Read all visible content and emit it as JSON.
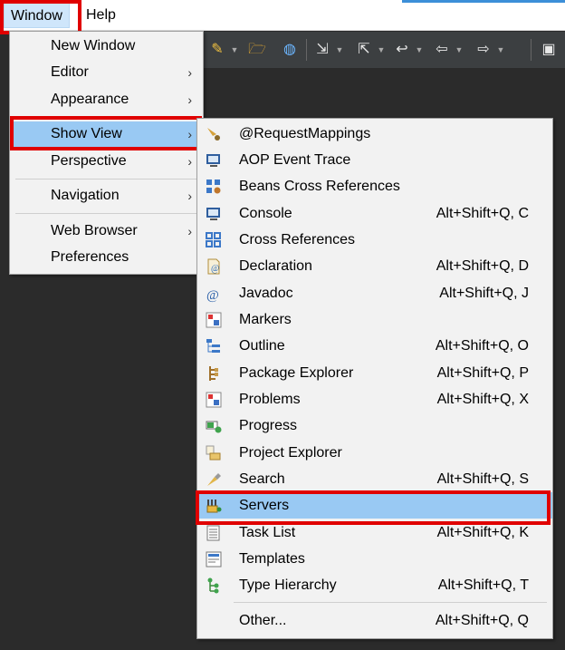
{
  "menubar": {
    "window_label": "Window",
    "help_label": "Help"
  },
  "toolbar": {
    "icons": [
      "pencil-icon",
      "folder-open-icon",
      "globe-icon",
      "export-icon",
      "import-icon",
      "back-history-icon",
      "back-icon",
      "forward-icon",
      "maximize-icon"
    ]
  },
  "window_menu": {
    "items": [
      {
        "label": "New Window",
        "submenu": false
      },
      {
        "label": "Editor",
        "submenu": true
      },
      {
        "label": "Appearance",
        "submenu": true
      },
      {
        "label": "Show View",
        "submenu": true,
        "selected": true
      },
      {
        "label": "Perspective",
        "submenu": true
      },
      {
        "label": "Navigation",
        "submenu": true
      },
      {
        "label": "Web Browser",
        "submenu": true
      },
      {
        "label": "Preferences",
        "submenu": false
      }
    ]
  },
  "show_view_menu": {
    "items": [
      {
        "label": "@RequestMappings",
        "shortcut": "",
        "icon": "request-mappings-icon"
      },
      {
        "label": "AOP Event Trace",
        "shortcut": "",
        "icon": "aop-trace-icon"
      },
      {
        "label": "Beans Cross References",
        "shortcut": "",
        "icon": "beans-xref-icon"
      },
      {
        "label": "Console",
        "shortcut": "Alt+Shift+Q, C",
        "icon": "console-icon"
      },
      {
        "label": "Cross References",
        "shortcut": "",
        "icon": "cross-references-icon"
      },
      {
        "label": "Declaration",
        "shortcut": "Alt+Shift+Q, D",
        "icon": "declaration-icon"
      },
      {
        "label": "Javadoc",
        "shortcut": "Alt+Shift+Q, J",
        "icon": "javadoc-icon"
      },
      {
        "label": "Markers",
        "shortcut": "",
        "icon": "markers-icon"
      },
      {
        "label": "Outline",
        "shortcut": "Alt+Shift+Q, O",
        "icon": "outline-icon"
      },
      {
        "label": "Package Explorer",
        "shortcut": "Alt+Shift+Q, P",
        "icon": "package-explorer-icon"
      },
      {
        "label": "Problems",
        "shortcut": "Alt+Shift+Q, X",
        "icon": "problems-icon"
      },
      {
        "label": "Progress",
        "shortcut": "",
        "icon": "progress-icon"
      },
      {
        "label": "Project Explorer",
        "shortcut": "",
        "icon": "project-explorer-icon"
      },
      {
        "label": "Search",
        "shortcut": "Alt+Shift+Q, S",
        "icon": "search-icon"
      },
      {
        "label": "Servers",
        "shortcut": "",
        "icon": "servers-icon",
        "selected": true
      },
      {
        "label": "Task List",
        "shortcut": "Alt+Shift+Q, K",
        "icon": "task-list-icon"
      },
      {
        "label": "Templates",
        "shortcut": "",
        "icon": "templates-icon"
      },
      {
        "label": "Type Hierarchy",
        "shortcut": "Alt+Shift+Q, T",
        "icon": "type-hierarchy-icon"
      },
      {
        "label": "Other...",
        "shortcut": "Alt+Shift+Q, Q",
        "icon": ""
      }
    ]
  },
  "colors": {
    "highlight": "#99c9f3",
    "annotation_red": "#e00000",
    "menu_bg": "#f2f2f2",
    "dark_bg": "#2b2b2b"
  }
}
